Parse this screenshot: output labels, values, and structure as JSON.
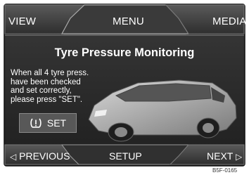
{
  "header": {
    "tabs": [
      {
        "label": "VIEW"
      },
      {
        "label": "MENU"
      },
      {
        "label": "MEDIA"
      }
    ]
  },
  "main": {
    "title": "Tyre Pressure Monitoring",
    "message_lines": [
      "When all 4 tyre press.",
      "have been checked",
      "and set correctly,",
      "please press \"SET\"."
    ],
    "set_button": {
      "label": "SET",
      "icon": "tyre-pressure-warning-icon"
    }
  },
  "footer": {
    "previous_label": "PREVIOUS",
    "setup_label": "SETUP",
    "next_label": "NEXT",
    "previous_icon": "triangle-left-icon",
    "next_icon": "triangle-right-icon"
  },
  "image_code": "B5F-0165",
  "colors": {
    "background": "#2a2a2a",
    "text": "#ffffff"
  }
}
